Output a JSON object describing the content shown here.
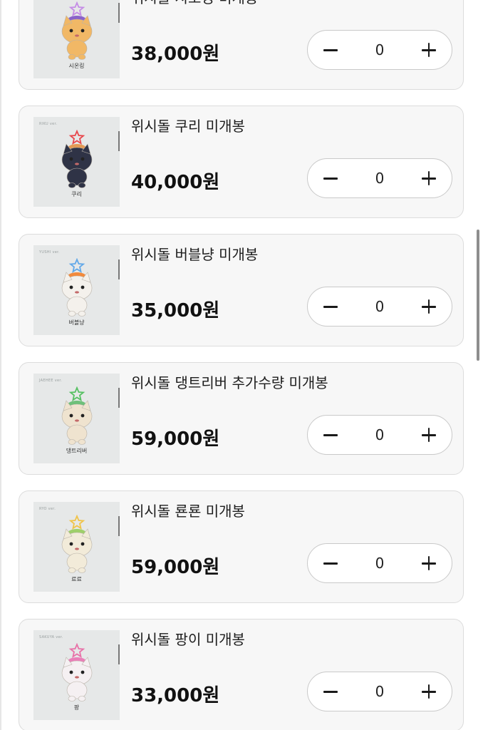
{
  "products": [
    {
      "ver": "SION ver.",
      "doll_name": "시온링",
      "title": "위시돌 시오닝 미개봉",
      "price": "38,000원",
      "qty": "0",
      "body": "#f1b866",
      "hat": "#8a63c9",
      "star": "#c58de6"
    },
    {
      "ver": "RIKU ver.",
      "doll_name": "쿠리",
      "title": "위시돌 쿠리 미개봉",
      "price": "40,000원",
      "qty": "0",
      "body": "#2f3346",
      "hat": "#e39a54",
      "star": "#e8484d"
    },
    {
      "ver": "YUSHI ver.",
      "doll_name": "버블냥",
      "title": "위시돌 버블냥 미개봉",
      "price": "35,000원",
      "qty": "0",
      "body": "#f4f1ec",
      "hat": "#f28a3c",
      "star": "#62a8e8"
    },
    {
      "ver": "JAEHEE ver.",
      "doll_name": "댕트리버",
      "title": "위시돌 댕트리버 추가수량 미개봉",
      "price": "59,000원",
      "qty": "0",
      "body": "#efe3cf",
      "hat": "#6ec07a",
      "star": "#57c163"
    },
    {
      "ver": "RYO ver.",
      "doll_name": "료료",
      "title": "위시돌 룐룐 미개봉",
      "price": "59,000원",
      "qty": "0",
      "body": "#f2ebd9",
      "hat": "#9fcf6a",
      "star": "#f0c44a"
    },
    {
      "ver": "SAKUYA ver.",
      "doll_name": "팡",
      "title": "위시돌 팡이 미개봉",
      "price": "33,000원",
      "qty": "0",
      "body": "#f5f0f2",
      "hat": "#ea7fb8",
      "star": "#e872a8"
    }
  ]
}
